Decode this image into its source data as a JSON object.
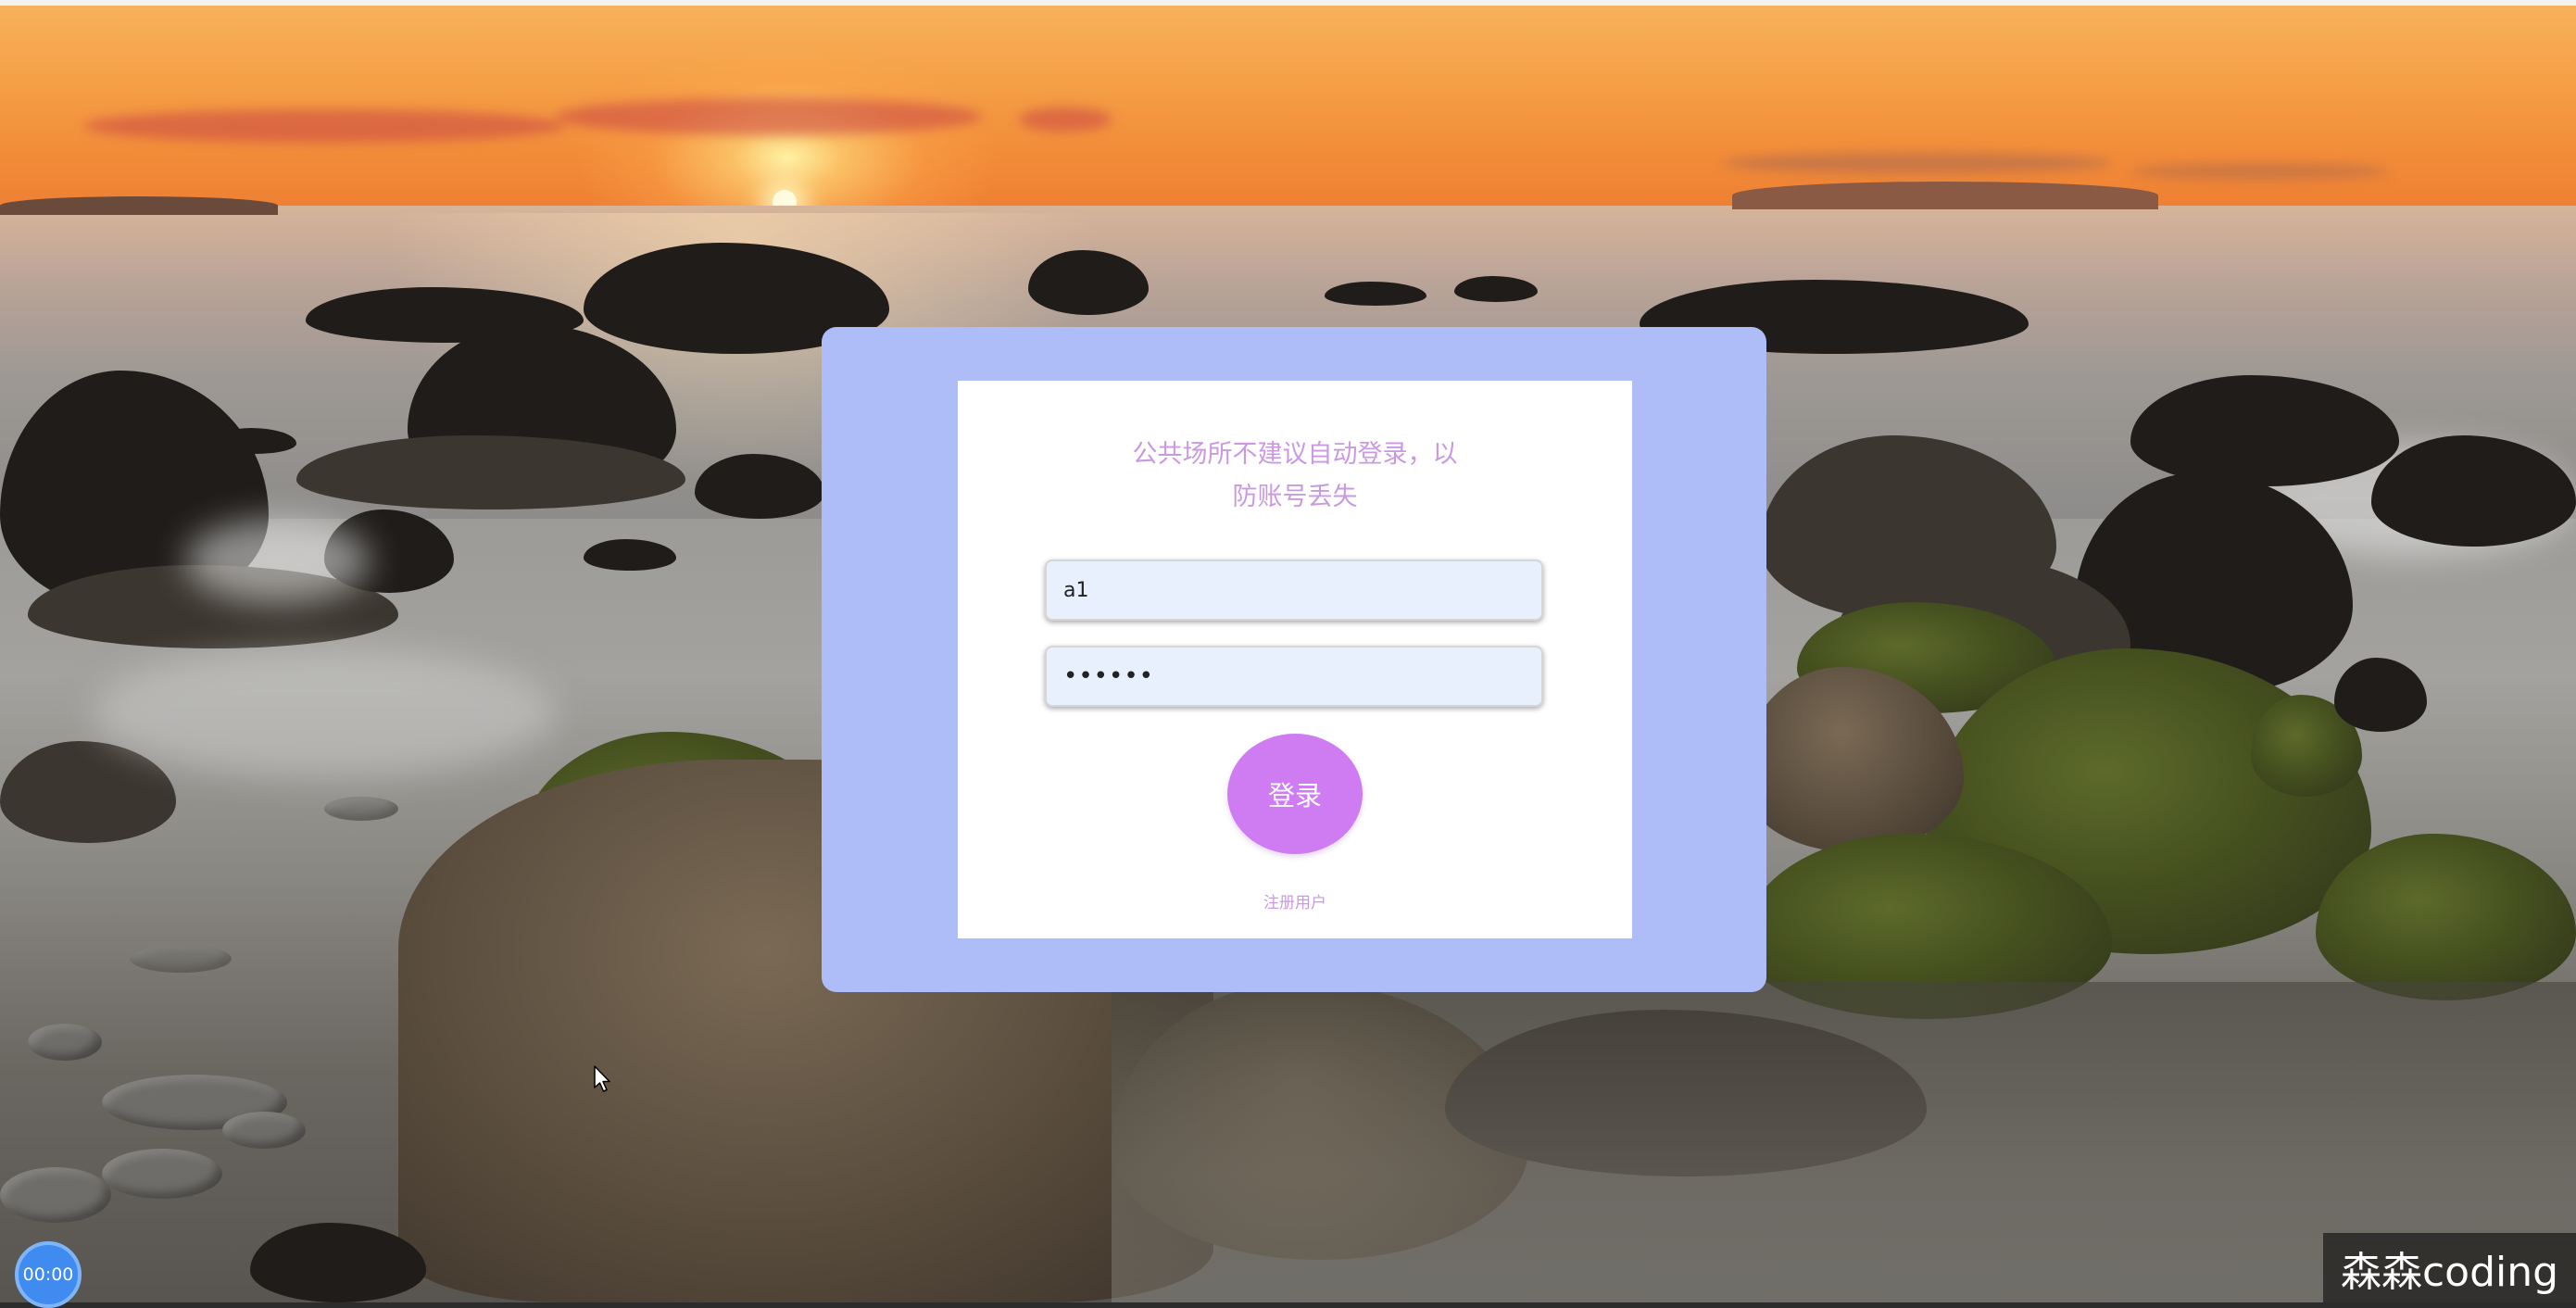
{
  "login": {
    "notice": "公共场所不建议自动登录，以防账号丢失",
    "username_value": "a1",
    "password_value": "••••••",
    "login_button": "登录",
    "register_link": "注册用户"
  },
  "overlay": {
    "timer": "00:00",
    "watermark": "森森coding"
  },
  "colors": {
    "modal_frame": "#aebdf8",
    "accent_purple": "#cf7cf3",
    "notice_text": "#c99ae3",
    "input_bg": "#e8f0fe"
  },
  "icons": {
    "cursor": "mouse-pointer-icon"
  }
}
